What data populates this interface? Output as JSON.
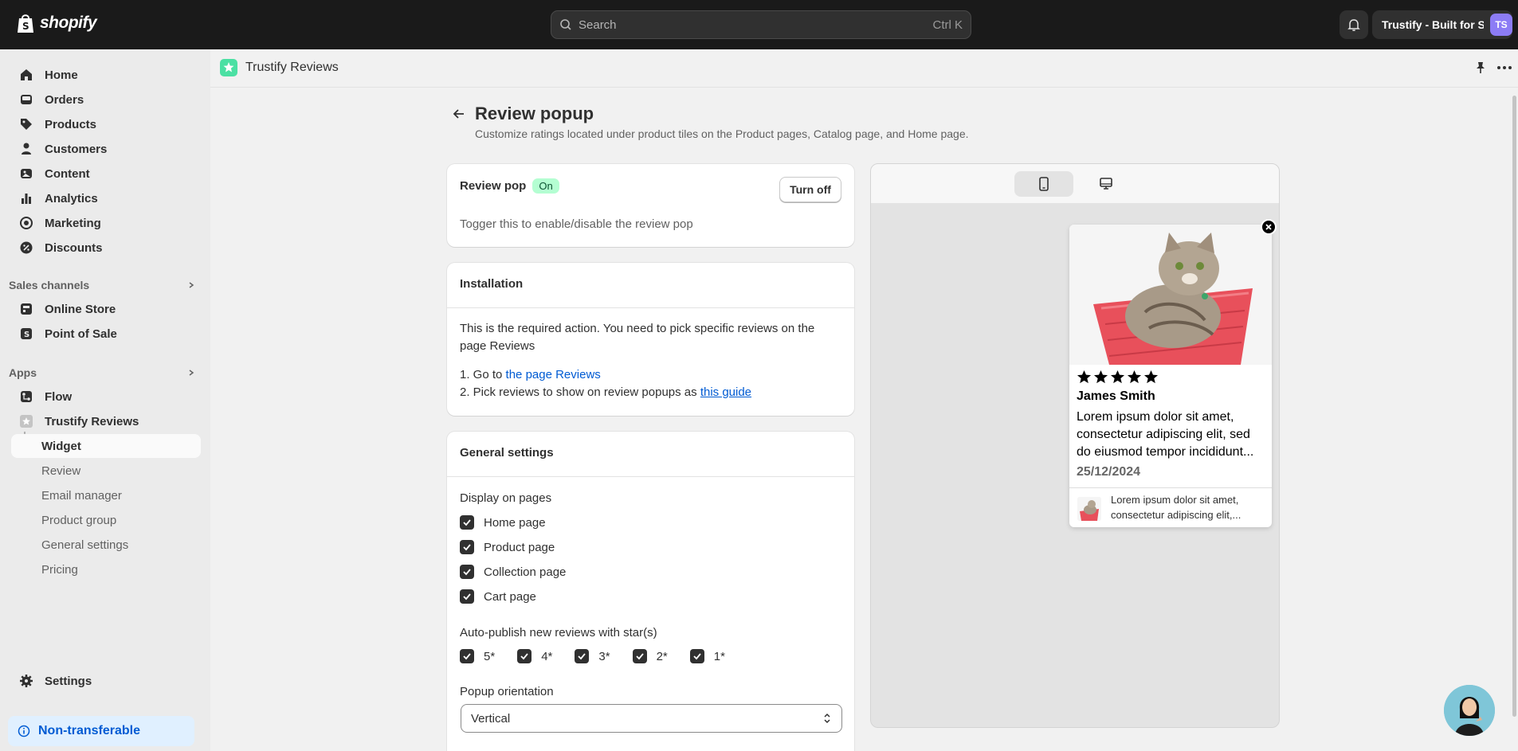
{
  "topbar": {
    "logo_text": "shopify",
    "search_placeholder": "Search",
    "search_shortcut": "Ctrl K",
    "store_name": "Trustify - Built for S",
    "avatar_initials": "TS"
  },
  "sidebar": {
    "items": [
      {
        "label": "Home",
        "icon": "home-icon"
      },
      {
        "label": "Orders",
        "icon": "inbox-icon"
      },
      {
        "label": "Products",
        "icon": "tag-icon"
      },
      {
        "label": "Customers",
        "icon": "person-icon"
      },
      {
        "label": "Content",
        "icon": "image-icon"
      },
      {
        "label": "Analytics",
        "icon": "bar-chart-icon"
      },
      {
        "label": "Marketing",
        "icon": "target-icon"
      },
      {
        "label": "Discounts",
        "icon": "discount-icon"
      }
    ],
    "sales_channels_label": "Sales channels",
    "sales_channels": [
      {
        "label": "Online Store",
        "icon": "store-icon"
      },
      {
        "label": "Point of Sale",
        "icon": "pos-icon"
      }
    ],
    "apps_label": "Apps",
    "apps": [
      {
        "label": "Flow",
        "icon": "flow-icon"
      },
      {
        "label": "Trustify Reviews",
        "icon": "trustify-icon"
      }
    ],
    "app_subitems": [
      "Widget",
      "Review",
      "Email manager",
      "Product group",
      "General settings",
      "Pricing"
    ],
    "settings_label": "Settings",
    "non_transferable_label": "Non-transferable"
  },
  "appbar": {
    "title": "Trustify Reviews"
  },
  "page": {
    "title": "Review popup",
    "subtitle": "Customize ratings located under product tiles on the Product pages, Catalog page, and Home page."
  },
  "review_pop_card": {
    "title": "Review pop",
    "status": "On",
    "button": "Turn off",
    "description": "Togger this to enable/disable the review pop"
  },
  "installation_card": {
    "title": "Installation",
    "text": "This is the required action. You need to pick specific reviews on the page Reviews",
    "step1_prefix": "1. Go to ",
    "step1_link": "the page Reviews",
    "step2_prefix": "2. Pick reviews to show on review popups as ",
    "step2_link": "this guide"
  },
  "general_card": {
    "title": "General settings",
    "display_label": "Display on pages",
    "pages": [
      "Home page",
      "Product page",
      "Collection page",
      "Cart page"
    ],
    "auto_publish_label": "Auto-publish new reviews with star(s)",
    "stars": [
      "5*",
      "4*",
      "3*",
      "2*",
      "1*"
    ],
    "orientation_label": "Popup orientation",
    "orientation_value": "Vertical"
  },
  "preview": {
    "reviewer": "James Smith",
    "review_text": "Lorem ipsum dolor sit amet, consectetur adipiscing elit, sed do eiusmod tempor incididunt...",
    "date": "25/12/2024",
    "mini_text": "Lorem ipsum dolor sit amet, consectetur adipiscing elit,...",
    "rating": 5
  },
  "colors": {
    "topbar": "#1a1a1a",
    "sidebar": "#ebebeb",
    "link": "#005bd3",
    "badge_on": "#b4fed2"
  }
}
